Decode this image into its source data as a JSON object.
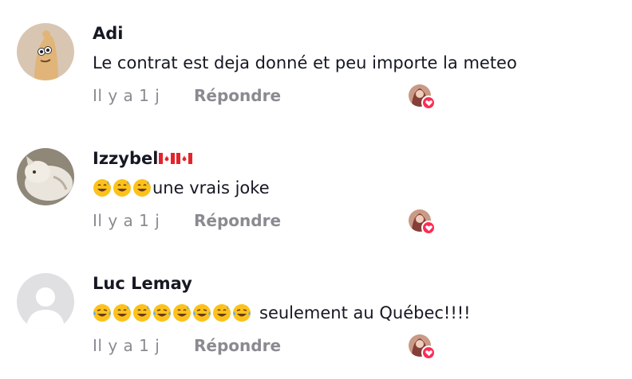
{
  "colors": {
    "meta_text": "#8a8b91",
    "heart": "#fe2c55",
    "text": "#161823"
  },
  "comments": [
    {
      "username": "Adi",
      "text": "Le contrat est deja donné et peu importe la meteo",
      "emoji_count": 0,
      "time": "Il y a 1 j",
      "reply_label": "Répondre",
      "avatar_icon": "character-avatar-icon",
      "creator_liked": true
    },
    {
      "username": "Izzybel",
      "flags": [
        "canada-flag-icon",
        "canada-flag-icon"
      ],
      "text": "une vrais joke",
      "emoji_count": 3,
      "time": "Il y a 1 j",
      "reply_label": "Répondre",
      "avatar_icon": "cat-photo-avatar-icon",
      "creator_liked": true
    },
    {
      "username": "Luc Lemay",
      "text": "seulement au Québec!!!!",
      "emoji_count": 8,
      "emoji_pattern": [
        "grinning-sweat-icon",
        "grinning-sweat-icon",
        "grinning-sweat-icon",
        "tears-of-joy-icon",
        "grinning-sweat-icon",
        "tears-of-joy-icon",
        "grinning-sweat-icon",
        "tears-of-joy-icon"
      ],
      "time": "Il y a 1 j",
      "reply_label": "Répondre",
      "avatar_icon": "default-user-avatar-icon",
      "creator_liked": true
    }
  ]
}
